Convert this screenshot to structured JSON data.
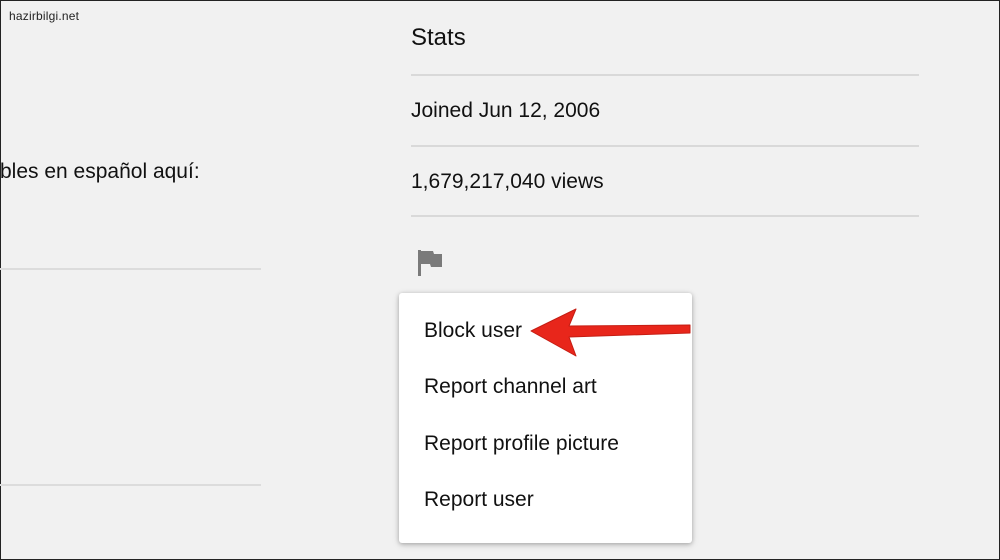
{
  "watermark": "hazirbilgi.net",
  "left": {
    "description_fragment": "bles en español aquí:"
  },
  "stats": {
    "title": "Stats",
    "joined": "Joined Jun 12, 2006",
    "views": "1,679,217,040 views"
  },
  "flag": {
    "icon": "flag-icon"
  },
  "menu": {
    "items": [
      {
        "label": "Block user"
      },
      {
        "label": "Report channel art"
      },
      {
        "label": "Report profile picture"
      },
      {
        "label": "Report user"
      }
    ]
  },
  "colors": {
    "background": "#f1f1f1",
    "menu_background": "#ffffff",
    "divider": "#d9d9d9",
    "flag_icon": "#7a7a7a",
    "annotation_arrow": "#e8261b"
  }
}
